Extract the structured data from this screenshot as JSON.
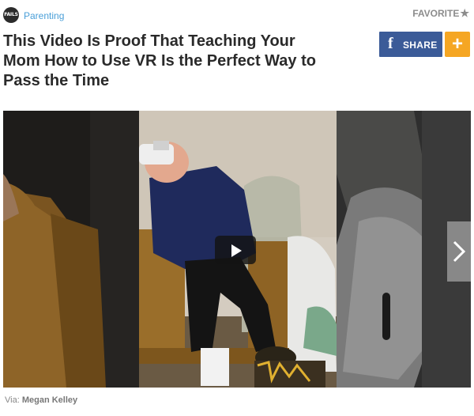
{
  "header": {
    "logo_text": "FAILS",
    "category": "Parenting",
    "favorite_label": "FAVORITE",
    "favorite_icon": "★"
  },
  "article": {
    "title": "This Video Is Proof That Teaching Your Mom How to Use VR Is the Perfect Way to Pass the Time"
  },
  "share": {
    "facebook_glyph": "f",
    "label": "SHARE",
    "more_glyph": "+",
    "facebook_color": "#3b5b98",
    "more_color": "#f5a623"
  },
  "media": {
    "play_icon": "play-icon",
    "next_icon": "chevron-right-icon"
  },
  "credit": {
    "prefix": "Via:",
    "author": "Megan Kelley"
  }
}
